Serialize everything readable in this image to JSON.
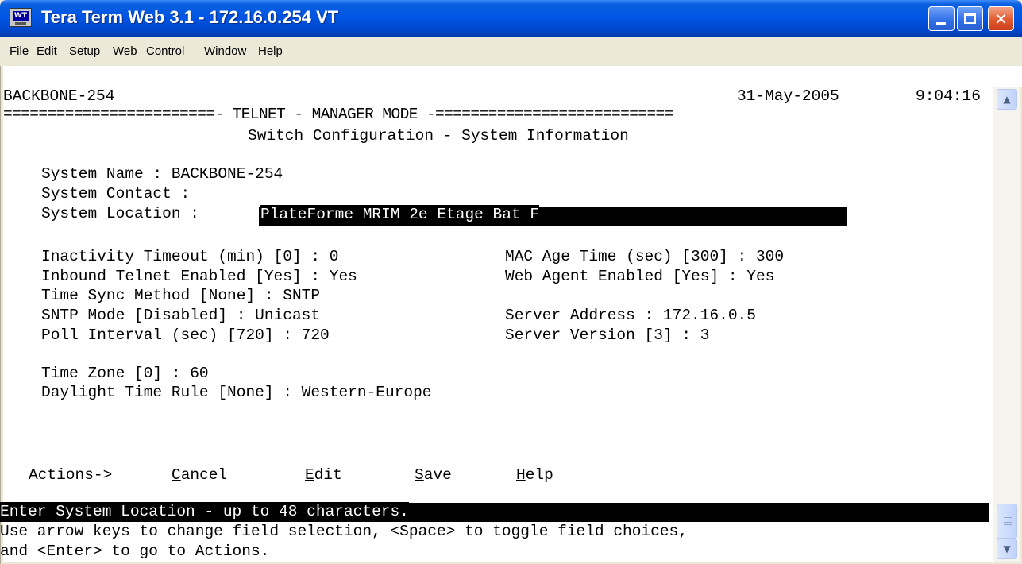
{
  "window": {
    "title": "Tera Term Web 3.1 - 172.16.0.254 VT",
    "icon_label": "WT",
    "controls": [
      "minimize",
      "maximize",
      "close"
    ]
  },
  "menu": [
    "File",
    "Edit",
    "Setup",
    "Web",
    "Control",
    "Window",
    "Help"
  ],
  "terminal": {
    "hostname": "BACKBONE-254",
    "date": "31-May-2005",
    "time": "9:04:16",
    "banner": "========================- TELNET - MANAGER MODE -===========================",
    "screen_title": "Switch Configuration - System Information",
    "system_name": "System Name : BACKBONE-254",
    "system_contact": "System Contact :",
    "system_location_label": "System Location :",
    "system_location_value": "PlateForme MRIM 2e Etage Bat F",
    "inactivity_timeout": "Inactivity Timeout (min) [0] : 0",
    "mac_age_time": "MAC Age Time (sec) [300] : 300",
    "inbound_telnet": "Inbound Telnet Enabled [Yes] : Yes",
    "web_agent": "Web Agent Enabled [Yes] : Yes",
    "time_sync": "Time Sync Method [None] : SNTP",
    "sntp_mode": "SNTP Mode [Disabled] : Unicast",
    "server_address": "Server Address : 172.16.0.5",
    "poll_interval": "Poll Interval (sec) [720] : 720",
    "server_version": "Server Version [3] : 3",
    "time_zone": "Time Zone [0] : 60",
    "daylight_rule": "Daylight Time Rule [None] : Western-Europe",
    "actions_label": "Actions->",
    "actions": [
      {
        "hotkey": "C",
        "rest": "ancel"
      },
      {
        "hotkey": "E",
        "rest": "dit"
      },
      {
        "hotkey": "S",
        "rest": "ave"
      },
      {
        "hotkey": "H",
        "rest": "elp"
      }
    ],
    "status_line": "Enter System Location - up to 48 characters.",
    "help_line1": "Use arrow keys to change field selection, <Space> to toggle field choices,",
    "help_line2": "and <Enter> to go to Actions."
  }
}
